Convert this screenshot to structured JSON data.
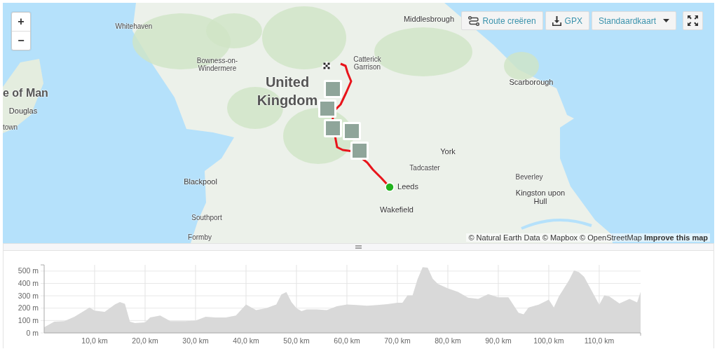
{
  "map": {
    "zoom_in": "+",
    "zoom_out": "−",
    "toolbar": [
      {
        "kind": "route",
        "label": "Route creëren"
      },
      {
        "kind": "download",
        "label": "GPX"
      },
      {
        "kind": "dropdown",
        "label": "Standaardkaart"
      },
      {
        "kind": "fullscreen"
      }
    ],
    "places": [
      {
        "name": "Whitehaven",
        "kind": "town"
      },
      {
        "name": "Middlesbrough",
        "kind": "city"
      },
      {
        "name": "Bowness-on-Windermere",
        "kind": "town"
      },
      {
        "name": "Catterick Garrison",
        "kind": "town"
      },
      {
        "name": "Scarborough",
        "kind": "city"
      },
      {
        "name": "e of Man",
        "kind": "region"
      },
      {
        "name": "United Kingdom",
        "kind": "country"
      },
      {
        "name": "Douglas",
        "kind": "city"
      },
      {
        "name": "town",
        "kind": "town"
      },
      {
        "name": "York",
        "kind": "city"
      },
      {
        "name": "Tadcaster",
        "kind": "town"
      },
      {
        "name": "Beverley",
        "kind": "town"
      },
      {
        "name": "Blackpool",
        "kind": "city"
      },
      {
        "name": "Leeds",
        "kind": "city"
      },
      {
        "name": "Kingston upon Hull",
        "kind": "city"
      },
      {
        "name": "Wakefield",
        "kind": "city"
      },
      {
        "name": "Southport",
        "kind": "town"
      },
      {
        "name": "Formby",
        "kind": "town"
      }
    ],
    "attribution": {
      "text": "© Natural Earth Data © Mapbox © OpenStreetMap",
      "link": "Improve this map"
    }
  },
  "elevation": {
    "chart_data": {
      "type": "area",
      "grid": true,
      "xlim": [
        0,
        118.2
      ],
      "ylim": [
        0,
        550
      ],
      "x": [
        0,
        2,
        4,
        6,
        8,
        9,
        10,
        12,
        14,
        15,
        16,
        17,
        18,
        20,
        21,
        23,
        25,
        28,
        30,
        32,
        34,
        36,
        38,
        40,
        42,
        44,
        46,
        47,
        48,
        49,
        50,
        51,
        52,
        54,
        56,
        58,
        60,
        62,
        64,
        66,
        68,
        70,
        71,
        72,
        73,
        74,
        75,
        76,
        77,
        78,
        80,
        82,
        84,
        86,
        88,
        90,
        92,
        94,
        95,
        96,
        98,
        100,
        101,
        102,
        104,
        105,
        106,
        107,
        108,
        110,
        111,
        112,
        114,
        116,
        117.5,
        118.2
      ],
      "series": [
        {
          "color": "#d9d9d9",
          "values": [
            45,
            90,
            95,
            130,
            180,
            205,
            180,
            170,
            230,
            250,
            235,
            90,
            80,
            85,
            125,
            140,
            95,
            95,
            100,
            130,
            125,
            125,
            140,
            230,
            185,
            200,
            230,
            310,
            330,
            250,
            200,
            175,
            190,
            190,
            185,
            215,
            230,
            225,
            220,
            225,
            232,
            243,
            243,
            303,
            303,
            435,
            532,
            528,
            438,
            397,
            360,
            331,
            285,
            275,
            313,
            288,
            288,
            163,
            150,
            206,
            228,
            270,
            206,
            294,
            425,
            506,
            490,
            453,
            378,
            228,
            303,
            294,
            238,
            275,
            247,
            331
          ]
        }
      ],
      "xticks": [
        {
          "value": 10,
          "label": "10,0 km"
        },
        {
          "value": 20,
          "label": "20,0 km"
        },
        {
          "value": 30,
          "label": "30,0 km"
        },
        {
          "value": 40,
          "label": "40,0 km"
        },
        {
          "value": 50,
          "label": "50,0 km"
        },
        {
          "value": 60,
          "label": "60,0 km"
        },
        {
          "value": 70,
          "label": "70,0 km"
        },
        {
          "value": 80,
          "label": "80,0 km"
        },
        {
          "value": 90,
          "label": "90,0 km"
        },
        {
          "value": 100,
          "label": "100,0 km"
        },
        {
          "value": 110,
          "label": "110,0 km"
        }
      ],
      "yticks": [
        {
          "value": 0,
          "label": "0 m"
        },
        {
          "value": 100,
          "label": "100 m"
        },
        {
          "value": 200,
          "label": "200 m"
        },
        {
          "value": 300,
          "label": "300 m"
        },
        {
          "value": 400,
          "label": "400 m"
        },
        {
          "value": 500,
          "label": "500 m"
        }
      ]
    }
  }
}
